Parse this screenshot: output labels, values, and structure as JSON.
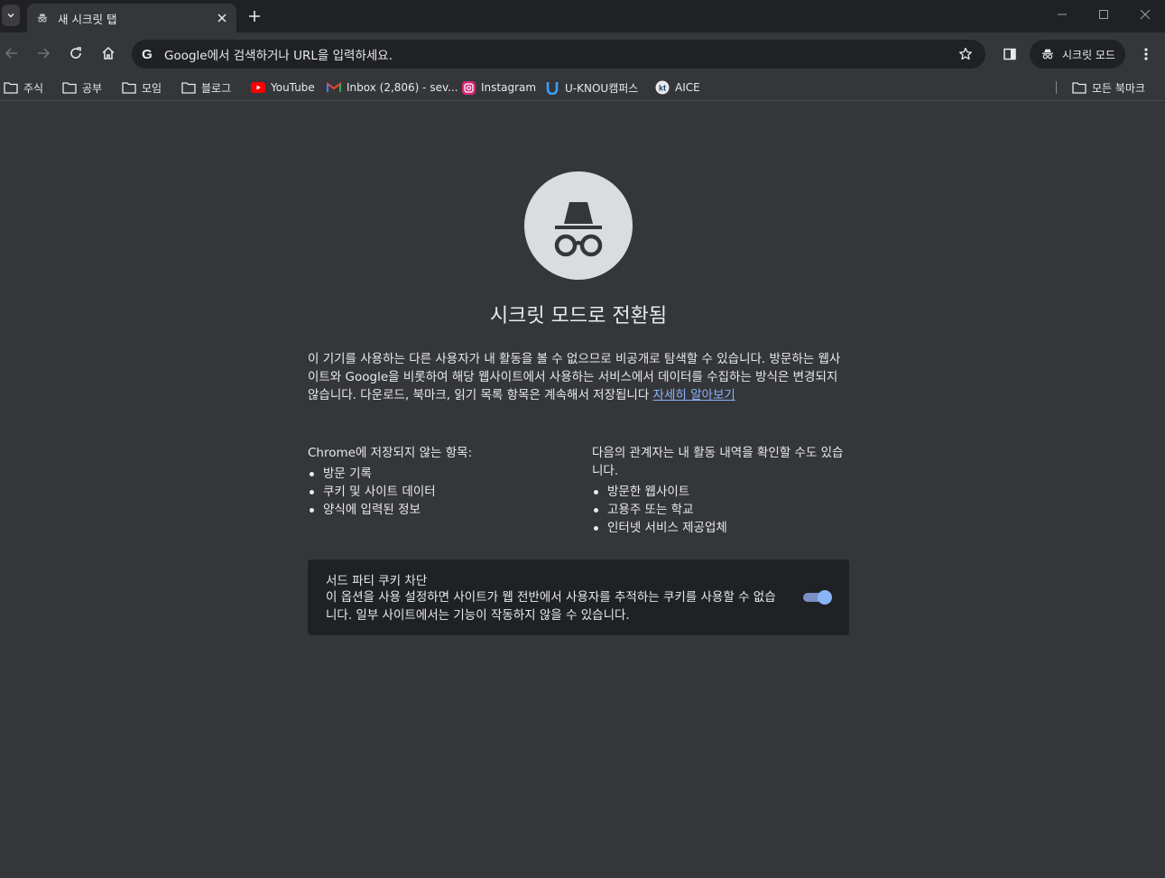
{
  "tab": {
    "title": "새 시크릿 탭"
  },
  "omnibox": {
    "placeholder": "Google에서 검색하거나 URL을 입력하세요."
  },
  "incognito_chip": {
    "label": "시크릿 모드"
  },
  "bookmarks": {
    "items": [
      {
        "label": "주식",
        "icon": "folder-icon"
      },
      {
        "label": "공부",
        "icon": "folder-icon"
      },
      {
        "label": "모임",
        "icon": "folder-icon"
      },
      {
        "label": "블로그",
        "icon": "folder-icon"
      },
      {
        "label": "YouTube",
        "icon": "youtube-icon"
      },
      {
        "label": "Inbox (2,806) - sev...",
        "icon": "gmail-icon"
      },
      {
        "label": "Instagram",
        "icon": "instagram-icon"
      },
      {
        "label": "U-KNOU캠퍼스",
        "icon": "uknou-icon"
      },
      {
        "label": "AICE",
        "icon": "aice-icon"
      }
    ],
    "all_bookmarks": "모든 북마크"
  },
  "ntp": {
    "title": "시크릿 모드로 전환됨",
    "intro": "이 기기를 사용하는 다른 사용자가 내 활동을 볼 수 없으므로 비공개로 탐색할 수 있습니다. 방문하는 웹사이트와 Google을 비롯하여 해당 웹사이트에서 사용하는 서비스에서 데이터를 수집하는 방식은 변경되지 않습니다. 다운로드, 북마크, 읽기 목록 항목은 계속해서 저장됩니다 ",
    "learn_more": "자세히 알아보기",
    "not_saved_heading": "Chrome에 저장되지 않는 항목:",
    "not_saved": [
      "방문 기록",
      "쿠키 및 사이트 데이터",
      "양식에 입력된 정보"
    ],
    "visible_heading": "다음의 관계자는 내 활동 내역을 확인할 수도 있습니다.",
    "visible": [
      "방문한 웹사이트",
      "고용주 또는 학교",
      "인터넷 서비스 제공업체"
    ],
    "cookie_title": "서드 파티 쿠키 차단",
    "cookie_desc": "이 옵션을 사용 설정하면 사이트가 웹 전반에서 사용자를 추적하는 쿠키를 사용할 수 없습니다. 일부 사이트에서는 기능이 작동하지 않을 수 있습니다.",
    "cookie_toggle_on": true
  },
  "colors": {
    "background": "#35363a",
    "tabstrip": "#202124",
    "accent": "#8ab4f8",
    "text": "#e8eaed"
  }
}
